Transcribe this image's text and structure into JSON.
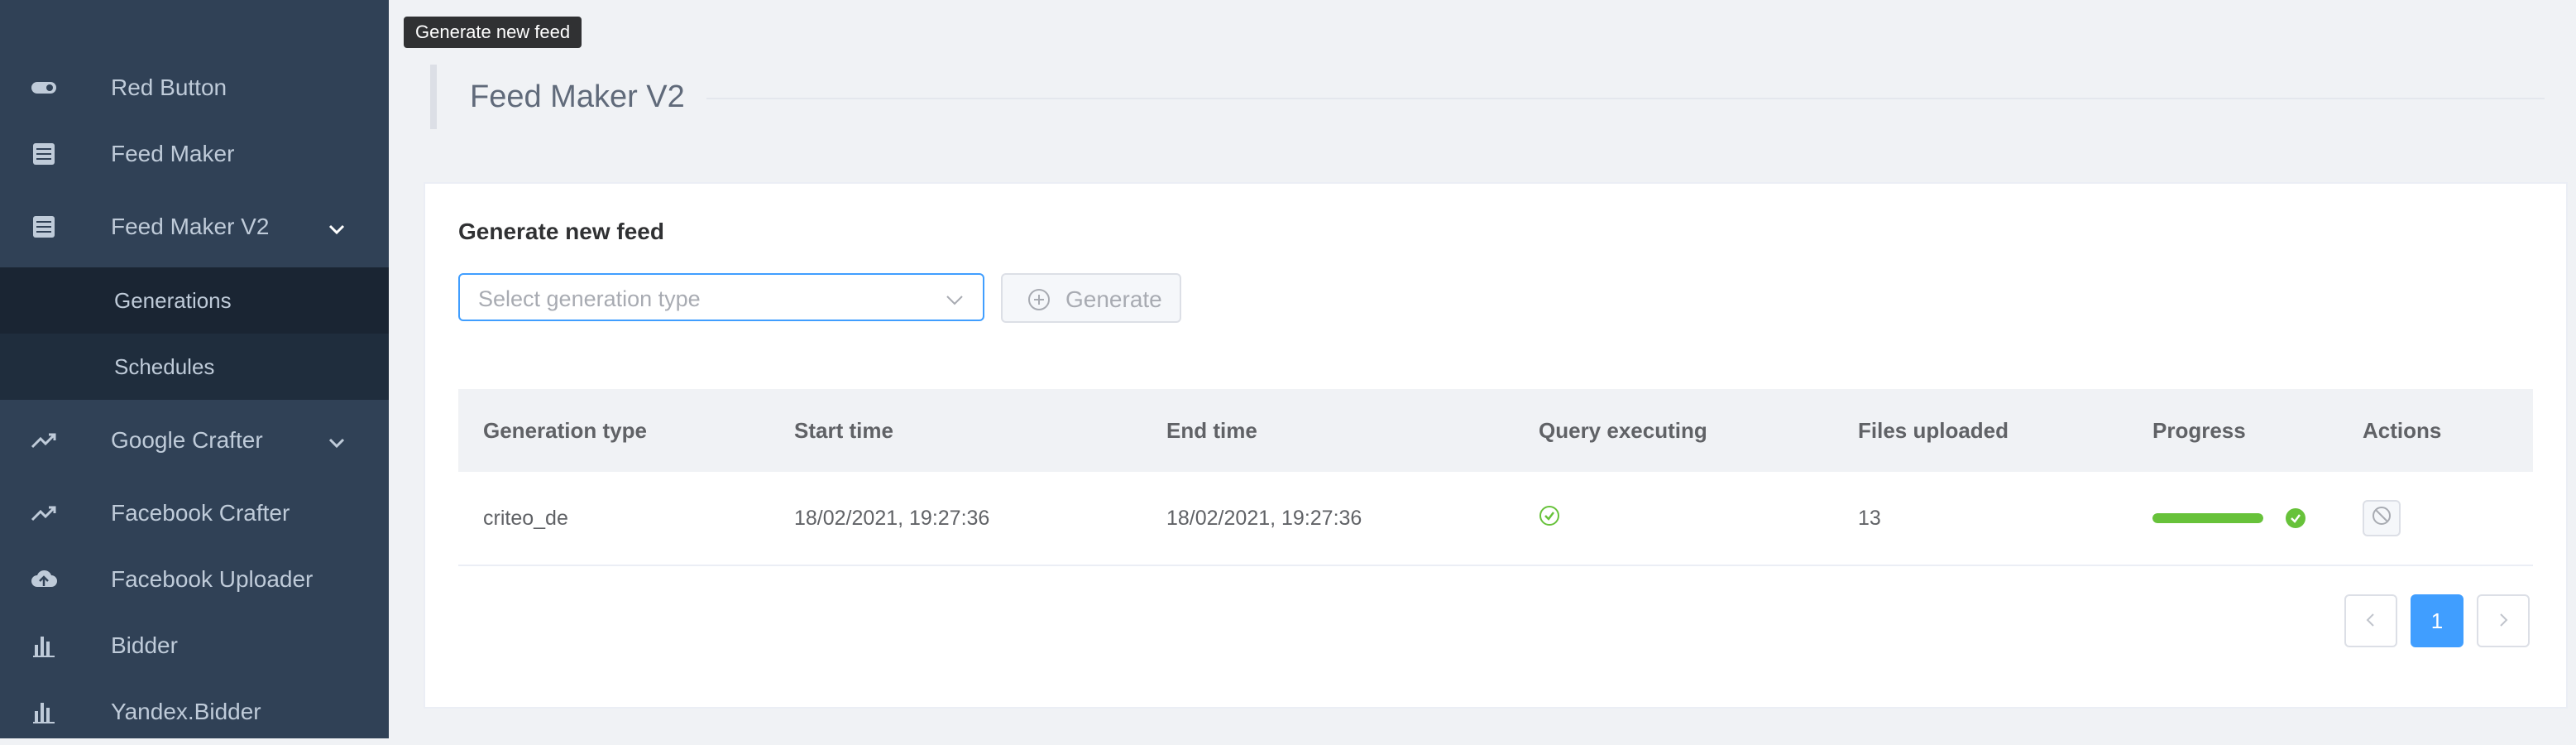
{
  "tooltip": "Generate new feed",
  "sidebar": {
    "items": [
      {
        "label": "Red Button",
        "icon": "toggle-icon"
      },
      {
        "label": "Feed Maker",
        "icon": "list-icon"
      },
      {
        "label": "Feed Maker V2",
        "icon": "list-icon",
        "expanded": true
      },
      {
        "label": "Google Crafter",
        "icon": "trend-icon"
      },
      {
        "label": "Facebook Crafter",
        "icon": "trend-icon"
      },
      {
        "label": "Facebook Uploader",
        "icon": "cloud-upload-icon"
      },
      {
        "label": "Bidder",
        "icon": "bar-chart-icon"
      },
      {
        "label": "Yandex.Bidder",
        "icon": "bar-chart-icon"
      }
    ],
    "submenu": [
      {
        "label": "Generations",
        "active": true
      },
      {
        "label": "Schedules"
      }
    ]
  },
  "header": {
    "title": "Feed Maker V2"
  },
  "card": {
    "title": "Generate new feed",
    "select_placeholder": "Select generation type",
    "generate_label": "Generate"
  },
  "table": {
    "columns": [
      "Generation type",
      "Start time",
      "End time",
      "Query executing",
      "Files uploaded",
      "Progress",
      "Actions"
    ],
    "rows": [
      {
        "generation_type": "criteo_de",
        "start_time": "18/02/2021, 19:27:36",
        "end_time": "18/02/2021, 19:27:36",
        "query_executing": "done",
        "files_uploaded": "13",
        "progress": 1.0
      }
    ]
  },
  "pagination": {
    "current_page": "1"
  },
  "colors": {
    "sidebar_bg": "#304156",
    "submenu_bg": "#1f2d3d",
    "accent": "#409eff",
    "success": "#67c23a"
  }
}
